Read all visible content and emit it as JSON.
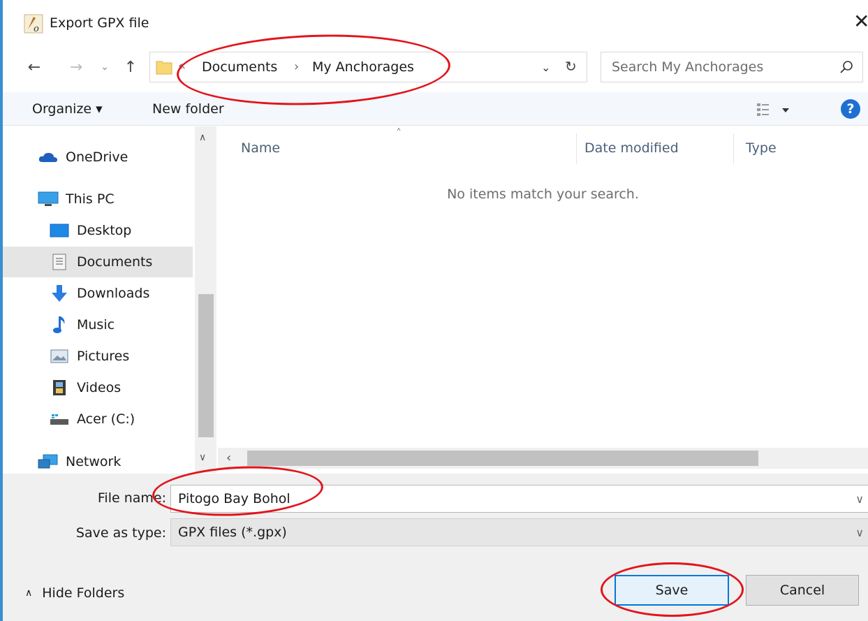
{
  "window": {
    "title": "Export GPX file",
    "close_glyph": "✕"
  },
  "navigation": {
    "back_glyph": "←",
    "forward_glyph": "→",
    "recent_glyph": "⌄",
    "up_glyph": "↑"
  },
  "address": {
    "overflow_glyph": "«",
    "crumbs": [
      "Documents",
      "My Anchorages"
    ],
    "separator": "›",
    "dropdown_glyph": "⌄",
    "refresh_glyph": "↻"
  },
  "search": {
    "placeholder": "Search My Anchorages"
  },
  "toolbar": {
    "organize_label": "Organize ▾",
    "new_folder_label": "New folder",
    "help_label": "?"
  },
  "nav_pane": {
    "items": [
      {
        "label": "OneDrive",
        "icon": "cloud-icon"
      },
      {
        "label": "This PC",
        "icon": "computer-icon"
      },
      {
        "label": "Desktop",
        "icon": "desktop-icon"
      },
      {
        "label": "Documents",
        "icon": "documents-icon",
        "selected": true
      },
      {
        "label": "Downloads",
        "icon": "download-arrow-icon"
      },
      {
        "label": "Music",
        "icon": "music-note-icon"
      },
      {
        "label": "Pictures",
        "icon": "pictures-icon"
      },
      {
        "label": "Videos",
        "icon": "film-icon"
      },
      {
        "label": "Acer (C:)",
        "icon": "drive-icon"
      },
      {
        "label": "Network",
        "icon": "network-icon"
      }
    ]
  },
  "file_list": {
    "columns": [
      "Name",
      "Date modified",
      "Type"
    ],
    "empty_message": "No items match your search."
  },
  "form": {
    "file_name_label": "File name:",
    "file_name_value": "Pitogo Bay Bohol",
    "save_type_label": "Save as type:",
    "save_type_value": "GPX files (*.gpx)"
  },
  "footer": {
    "hide_folders_label": "Hide Folders",
    "save_label": "Save",
    "cancel_label": "Cancel"
  },
  "colors": {
    "accent": "#0078d7",
    "annotation": "#e2141b",
    "selected_bg": "#e5e5e5"
  }
}
